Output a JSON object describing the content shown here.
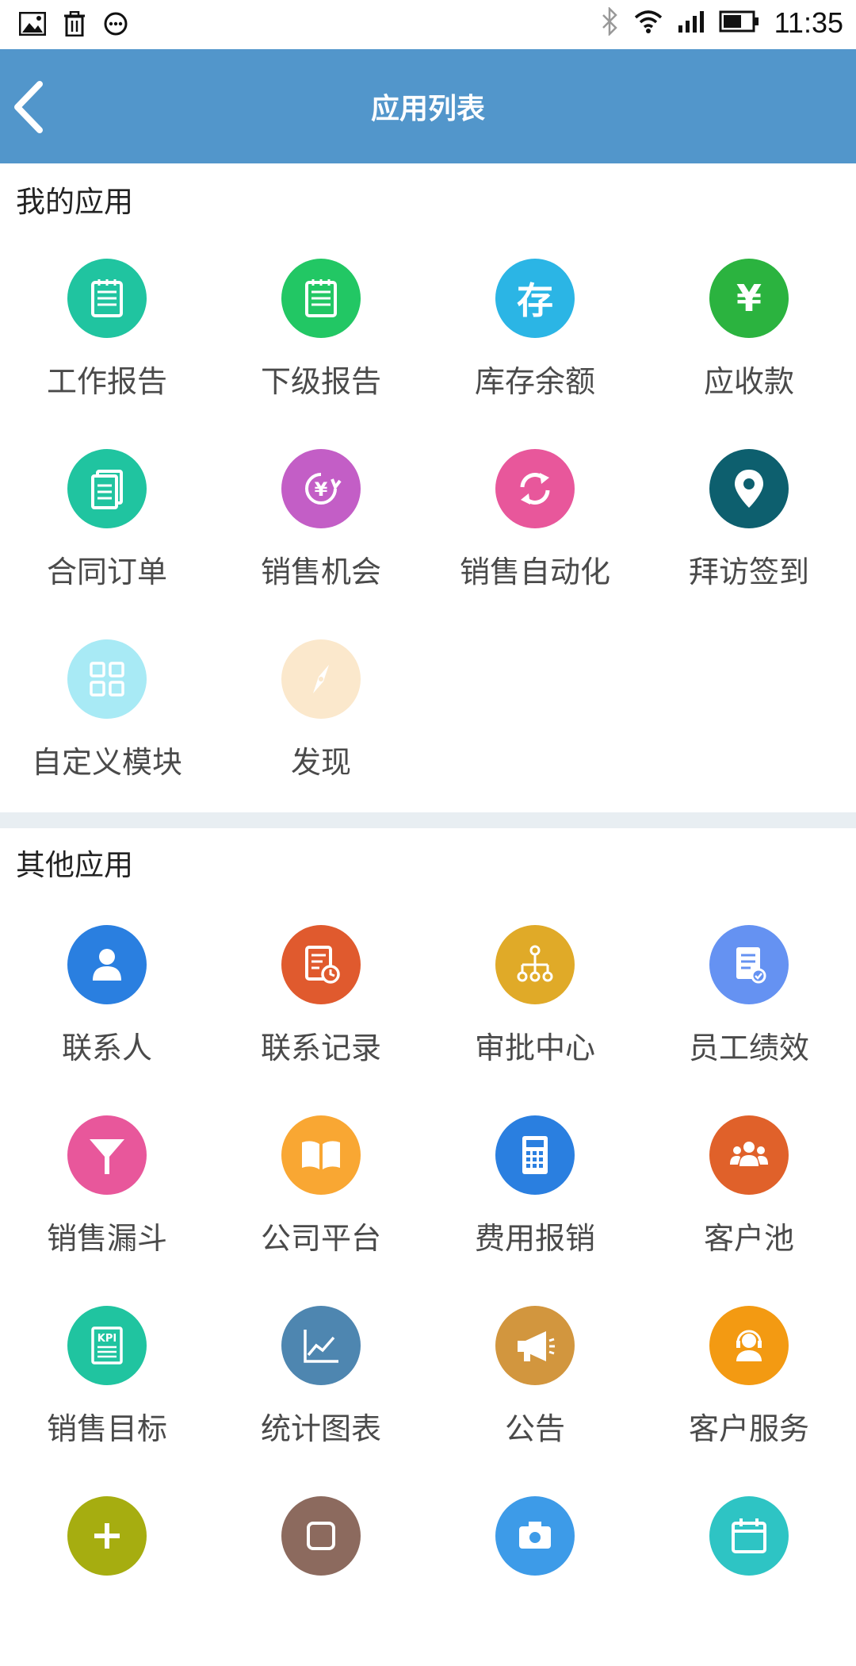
{
  "status_bar": {
    "time": "11:35"
  },
  "header": {
    "title": "应用列表"
  },
  "my_apps": {
    "title": "我的应用",
    "items": [
      {
        "label": "工作报告",
        "color": "#20c4a0",
        "icon": "report-icon"
      },
      {
        "label": "下级报告",
        "color": "#22c764",
        "icon": "report-icon"
      },
      {
        "label": "库存余额",
        "color": "#2bb5e5",
        "icon": "inventory-icon",
        "glyph": "存"
      },
      {
        "label": "应收款",
        "color": "#2bb33f",
        "icon": "yen-icon",
        "glyph": "¥"
      },
      {
        "label": "合同订单",
        "color": "#20c4a0",
        "icon": "document-icon"
      },
      {
        "label": "销售机会",
        "color": "#c35ec6",
        "icon": "yen-cycle-icon"
      },
      {
        "label": "销售自动化",
        "color": "#e8579b",
        "icon": "refresh-icon"
      },
      {
        "label": "拜访签到",
        "color": "#0d5f6e",
        "icon": "location-pin-icon"
      },
      {
        "label": "自定义模块",
        "color": "#a8eaf5",
        "icon": "grid-icon"
      },
      {
        "label": "发现",
        "color": "#fbe8cc",
        "icon": "compass-icon"
      }
    ]
  },
  "other_apps": {
    "title": "其他应用",
    "items": [
      {
        "label": "联系人",
        "color": "#2a7fe0",
        "icon": "person-icon"
      },
      {
        "label": "联系记录",
        "color": "#e05a2e",
        "icon": "record-clock-icon"
      },
      {
        "label": "审批中心",
        "color": "#e0aa28",
        "icon": "org-tree-icon"
      },
      {
        "label": "员工绩效",
        "color": "#6592f2",
        "icon": "performance-icon"
      },
      {
        "label": "销售漏斗",
        "color": "#e8579b",
        "icon": "funnel-icon"
      },
      {
        "label": "公司平台",
        "color": "#f9a733",
        "icon": "book-icon"
      },
      {
        "label": "费用报销",
        "color": "#2a7fe0",
        "icon": "calculator-icon"
      },
      {
        "label": "客户池",
        "color": "#e0612a",
        "icon": "group-icon"
      },
      {
        "label": "销售目标",
        "color": "#20c4a0",
        "icon": "kpi-icon"
      },
      {
        "label": "统计图表",
        "color": "#4e86b0",
        "icon": "line-chart-icon"
      },
      {
        "label": "公告",
        "color": "#d2963e",
        "icon": "megaphone-icon"
      },
      {
        "label": "客户服务",
        "color": "#f39a12",
        "icon": "support-agent-icon"
      },
      {
        "label": "",
        "color": "#a6ad10",
        "icon": "add-icon"
      },
      {
        "label": "",
        "color": "#8c6a5e",
        "icon": "app-icon"
      },
      {
        "label": "",
        "color": "#3d9be8",
        "icon": "camera-icon"
      },
      {
        "label": "",
        "color": "#2ec4c4",
        "icon": "calendar-icon"
      }
    ]
  }
}
